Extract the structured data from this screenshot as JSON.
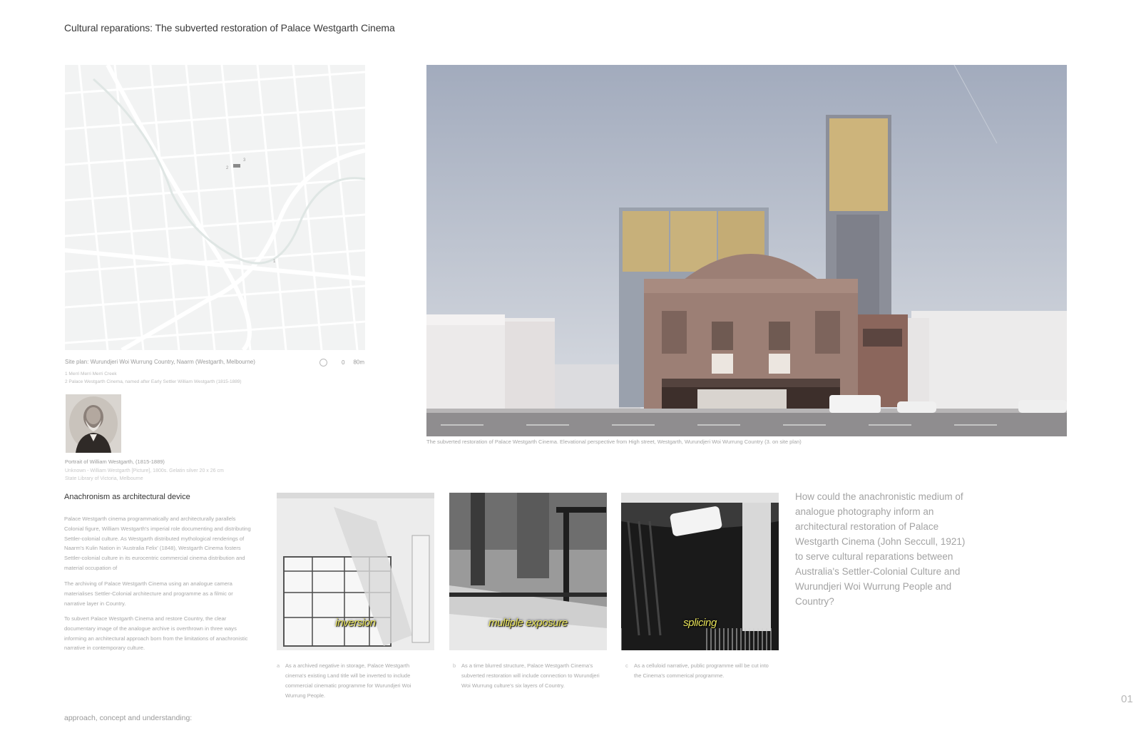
{
  "title": "Cultural reparations:  The subverted restoration of  Palace Westgarth Cinema",
  "site_plan": {
    "caption": "Site plan: Wurundjeri Woi Wurrung Country, Naarm (Westgarth, Melbourne)",
    "scale_start": "0",
    "scale_end": "80m",
    "legend_1": "1 Merri Merri Merri Creek",
    "legend_2": "2 Palace Westgarth Cinema, named after Early Settler William Westgarth (1815-1889)",
    "marker_1": "1",
    "marker_2": "2",
    "marker_3": "3"
  },
  "portrait": {
    "caption": "Portrait of William Westgarth, (1815-1889)",
    "credit_1": "Unknown - William Westgarth [Picture], 1800s. Gelatin silver 20 x 26 cm",
    "credit_2": "State Library of Victoria, Melbourne"
  },
  "hero": {
    "caption": "The subverted restoration of Palace Westgarth Cinema. Elevational perspective from High street, Westgarth, Wurundjeri Woi Wurrung Country (3. on site plan)"
  },
  "left_column": {
    "heading": "Anachronism as architectural device",
    "para1": "Palace Westgarth cinema programmatically and architecturally parallels Colonial figure, William Westgarth's imperial role documenting and distributing Settler-colonial culture. As Westgarth distributed mythological renderings  of Naarm's Kulin Nation  in 'Australia Felix' (1848), Westgarth Cinema fosters Settler-colonial culture in its eurocentric commercial cinema distribution and material occupation of",
    "para2": "The archiving of Palace Westgarth Cinema using an analogue camera materialises  Settler-Colonial architecture and programme as a filmic or narrative  layer in Country.",
    "para3": "To subvert Palace Westgarth Cinema and restore Country, the clear documentary image of the analogue archive is overthrown in three ways informing an architectural approach born from the limitations of anachronistic narrative in contemporary culture."
  },
  "photos": [
    {
      "label": "inversion",
      "letter": "a",
      "caption": "As a archived negative in storage, Palace Westgarth cinema's existing Land title will be inverted to include commercial cinematic programme for Wurundjeri Woi Wurrung People."
    },
    {
      "label": "multiple exposure",
      "letter": "b",
      "caption": "As a time blurred structure, Palace Westgarth Cinema's subverted restoration will include connection to Wurundjeri Woi Wurrung culture's six layers of Country."
    },
    {
      "label": "splicing",
      "letter": "c",
      "caption": "As a celluloid narrative, public programme will be cut into the Cinema's commerical programme."
    }
  ],
  "question": "How could the anachronistic medium of analogue photography inform an architectural restoration of Palace Westgarth Cinema (John Seccull, 1921) to serve cultural reparations between Australia's Settler-Colonial Culture and Wurundjeri Woi Wurrung People and Country?",
  "page_number": "01",
  "footer": "approach, concept and understanding:",
  "colors": {
    "sky": "#a9b2c3",
    "brick": "#9c7f75",
    "screen_gold": "#c9b27c",
    "caption_yellow": "#e8e35a"
  }
}
